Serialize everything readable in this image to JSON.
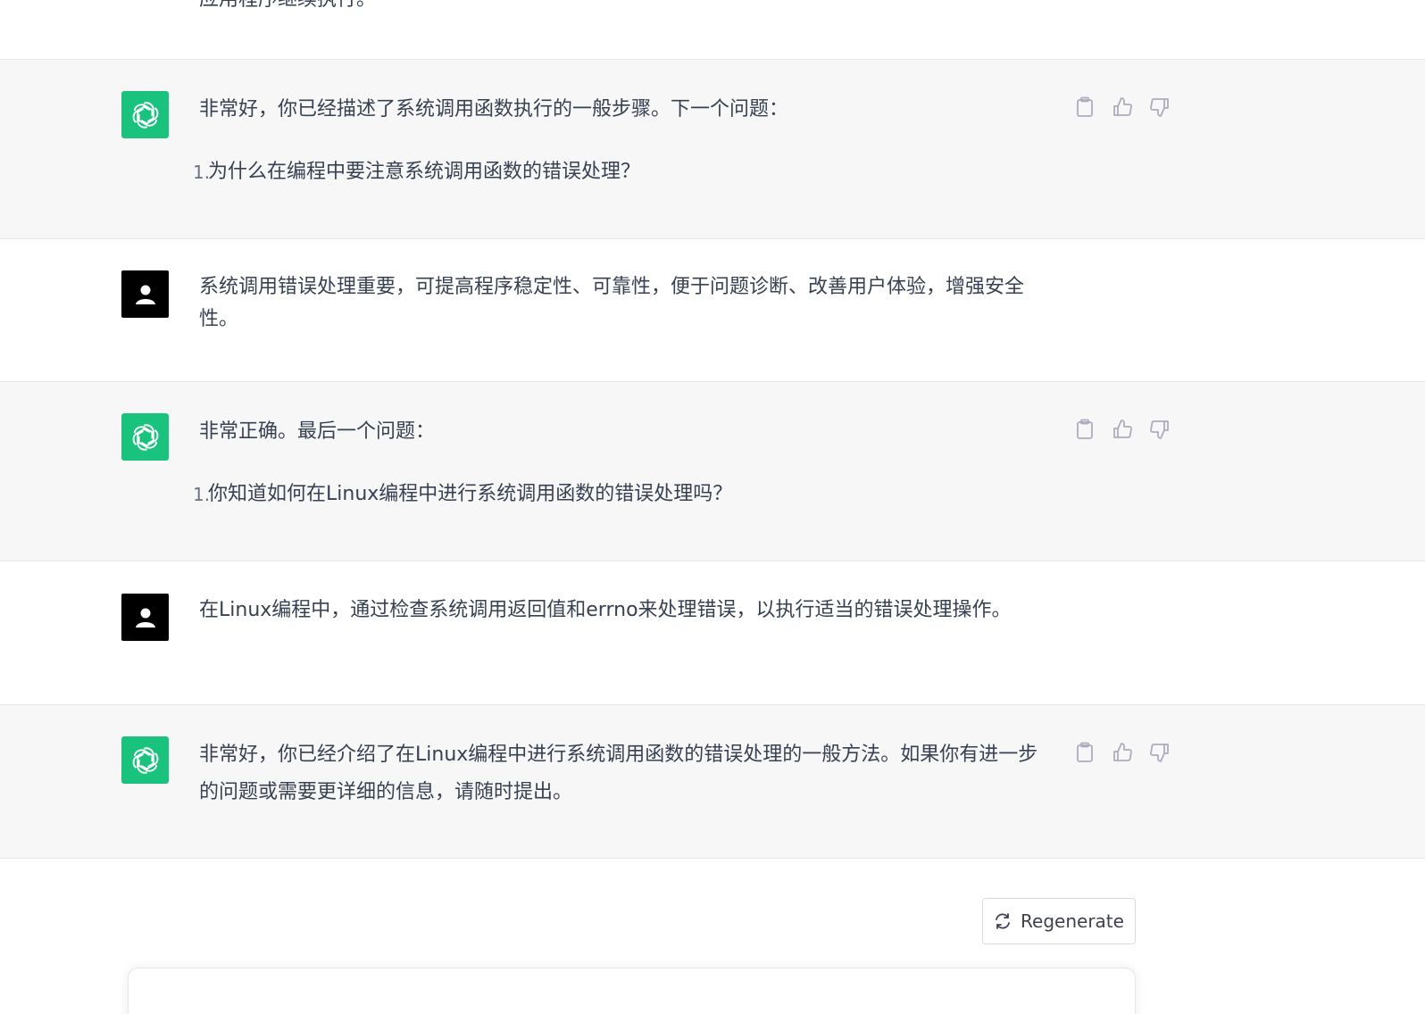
{
  "top_fragment": {
    "text": "应用程序继续执行。"
  },
  "messages": [
    {
      "role": "assistant",
      "intro": "非常好，你已经描述了系统调用函数执行的一般步骤。下一个问题：",
      "list": [
        {
          "num": "1.",
          "text": "为什么在编程中要注意系统调用函数的错误处理？"
        }
      ]
    },
    {
      "role": "user",
      "text": "系统调用错误处理重要，可提高程序稳定性、可靠性，便于问题诊断、改善用户体验，增强安全性。"
    },
    {
      "role": "assistant",
      "intro": "非常正确。最后一个问题：",
      "list": [
        {
          "num": "1.",
          "text": "你知道如何在Linux编程中进行系统调用函数的错误处理吗？"
        }
      ]
    },
    {
      "role": "user",
      "text": "在Linux编程中，通过检查系统调用返回值和errno来处理错误，以执行适当的错误处理操作。"
    },
    {
      "role": "assistant",
      "text": "非常好，你已经介绍了在Linux编程中进行系统调用函数的错误处理的一般方法。如果你有进一步的问题或需要更详细的信息，请随时提出。"
    }
  ],
  "actions": {
    "copy_icon": "clipboard-icon",
    "like_icon": "thumbs-up-icon",
    "dislike_icon": "thumbs-down-icon"
  },
  "regenerate": {
    "label": "Regenerate",
    "icon": "refresh-icon"
  },
  "colors": {
    "assistant_avatar_bg": "#19c37d",
    "user_avatar_bg": "#000000",
    "assistant_row_bg": "#f7f7f8",
    "text": "#374151"
  }
}
